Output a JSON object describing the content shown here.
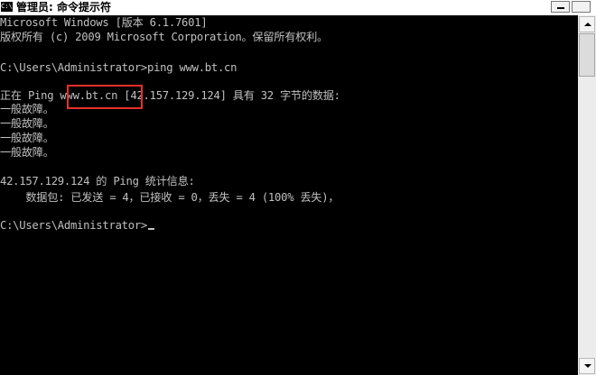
{
  "window": {
    "title": "管理员: 命令提示符",
    "icon": "cmd-icon",
    "icon_text": "C:\\"
  },
  "console_lines": [
    "Microsoft Windows [版本 6.1.7601]",
    "版权所有 (c) 2009 Microsoft Corporation。保留所有权利。",
    "",
    "C:\\Users\\Administrator>ping www.bt.cn",
    "",
    "正在 Ping www.bt.cn [42.157.129.124] 具有 32 字节的数据:",
    "一般故障。",
    "一般故障。",
    "一般故障。",
    "一般故障。",
    "",
    "42.157.129.124 的 Ping 统计信息:",
    "    数据包: 已发送 = 4，已接收 = 0，丢失 = 4 (100% 丢失)，",
    "",
    "C:\\Users\\Administrator>"
  ],
  "colors": {
    "background": "#000000",
    "text": "#c0c0c0",
    "highlight_box": "#e8302a"
  }
}
